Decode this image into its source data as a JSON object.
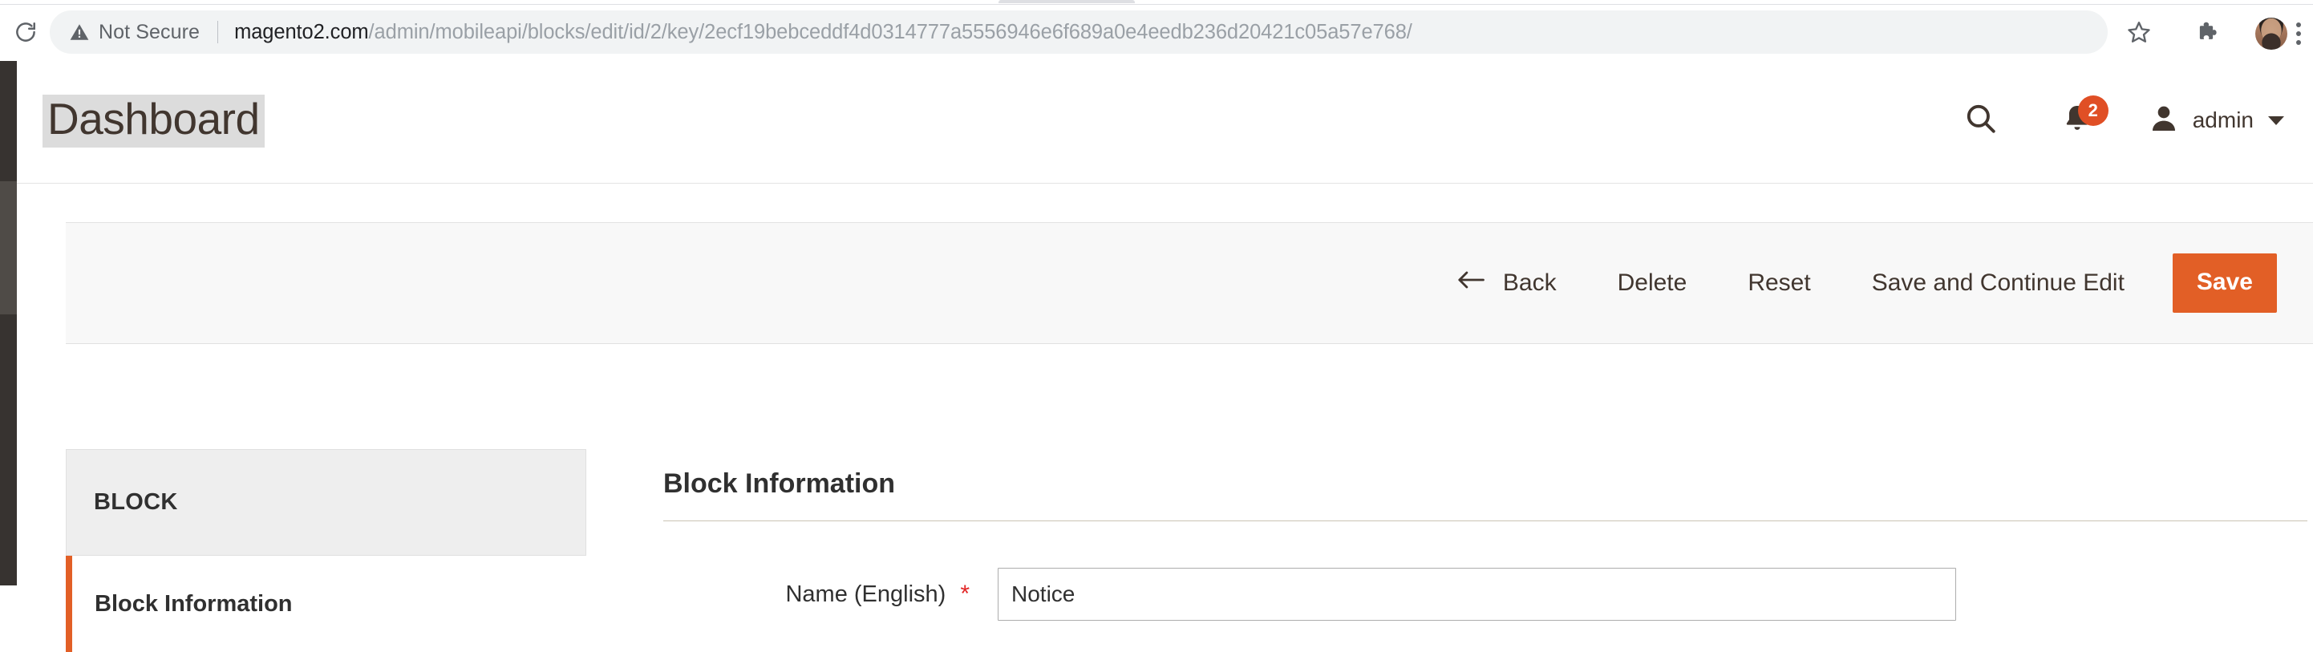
{
  "browser": {
    "reload_icon": "reload-icon",
    "security_label": "Not Secure",
    "warning_icon": "warning-triangle-icon",
    "url_host": "magento2.com",
    "url_path": "/admin/mobileapi/blocks/edit/id/2/key/2ecf19bebceddf4d0314777a5556946e6f689a0e4eedb236d20421c05a57e768/",
    "star_icon": "bookmark-star-icon",
    "extensions_icon": "puzzle-piece-icon",
    "profile_icon": "user-avatar-icon",
    "menu_icon": "three-dot-menu-icon"
  },
  "admin_header": {
    "page_title": "Dashboard",
    "search_icon": "magnifier-search-icon",
    "notifications_icon": "bell-notification-icon",
    "notifications_count": "2",
    "account_icon": "person-silhouette-icon",
    "account_name": "admin",
    "account_caret_icon": "caret-down-icon"
  },
  "page_actions": {
    "back_icon": "arrow-left-icon",
    "back_label": "Back",
    "delete_label": "Delete",
    "reset_label": "Reset",
    "save_continue_label": "Save and Continue Edit",
    "save_label": "Save"
  },
  "block_sidebar": {
    "header": "BLOCK",
    "items": [
      {
        "label": "Block Information",
        "active": true
      }
    ]
  },
  "form": {
    "legend": "Block Information",
    "fields": [
      {
        "label": "Name (English)",
        "required_marker": "*",
        "value": "Notice",
        "placeholder": ""
      }
    ]
  },
  "colors": {
    "accent_orange": "#e25f26",
    "badge_red": "#e04f25",
    "required_red": "#e22626",
    "nav_rail_dark": "#373330",
    "nav_rail_active": "#4f4b47",
    "toolbar_bg": "#f8f8f8",
    "sidebar_header_bg": "#eeeeee",
    "title_highlight": "#dcdcdc"
  }
}
